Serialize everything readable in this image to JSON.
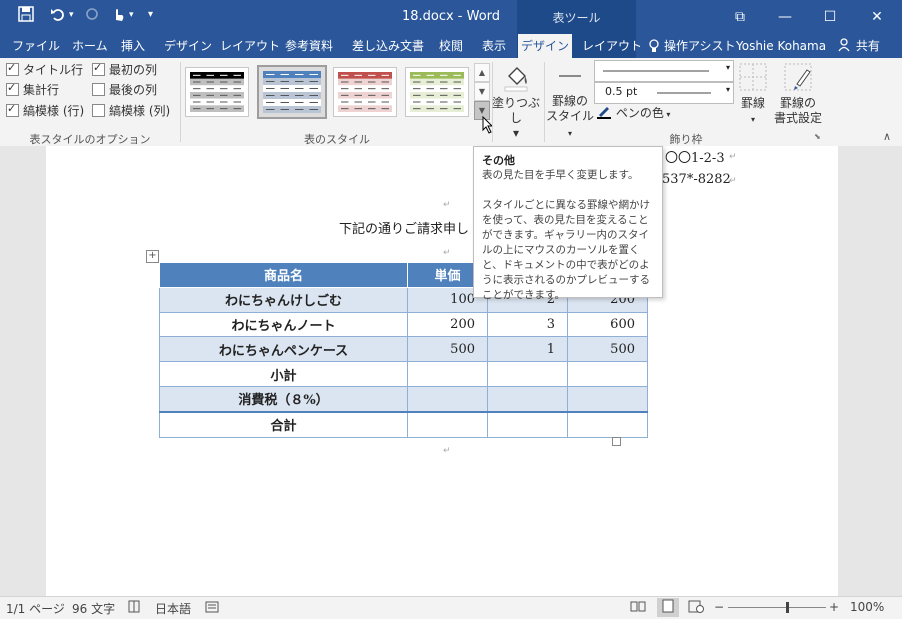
{
  "window": {
    "title": "18.docx - Word",
    "context_group": "表ツール",
    "qat": {
      "save_icon": "save-icon",
      "undo_icon": "undo-icon",
      "redo_icon": "redo-icon",
      "touch_icon": "touch-mode-icon",
      "more": "▾"
    },
    "buttons": {
      "ribbon_display": "⧉",
      "minimize": "—",
      "maximize": "☐",
      "close": "✕"
    }
  },
  "tabs": [
    "ファイル",
    "ホーム",
    "挿入",
    "デザイン",
    "レイアウト",
    "参考資料",
    "差し込み文書",
    "校閲",
    "表示",
    "デザイン",
    "レイアウト"
  ],
  "active_tab_index": 9,
  "tell_me": "操作アシスト",
  "user": "Yoshie Kohama",
  "share": "共有",
  "ribbon": {
    "style_options": {
      "items": [
        {
          "label": "タイトル行",
          "checked": true
        },
        {
          "label": "最初の列",
          "checked": true
        },
        {
          "label": "集計行",
          "checked": true
        },
        {
          "label": "最後の列",
          "checked": false
        },
        {
          "label": "縞模様 (行)",
          "checked": true
        },
        {
          "label": "縞模様 (列)",
          "checked": false
        }
      ],
      "group_label": "表スタイルのオプション"
    },
    "table_styles": {
      "group_label": "表のスタイル",
      "swatch_colors": [
        "#000000",
        "#4f81bd",
        "#c0504d",
        "#9bbb59"
      ],
      "selected_index": 1
    },
    "shading": {
      "label1": "塗りつぶし",
      "arrow": "▾"
    },
    "borders_group": {
      "border_styles_label": "罫線の",
      "border_styles_label2": "スタイル",
      "pen_weight": "0.5 pt",
      "pen_color": "ペンの色",
      "borders": "罫線",
      "border_painter1": "罫線の",
      "border_painter2": "書式設定",
      "group_label": "飾り枠"
    }
  },
  "document": {
    "address_line1": "〇〇1-2-3",
    "address_line2": "537*-8282",
    "body_line": "下記の通りご請求申し",
    "table": {
      "header": [
        "商品名",
        "単価"
      ],
      "rows": [
        [
          "わにちゃんけしごむ",
          "100",
          "2",
          "200"
        ],
        [
          "わにちゃんノート",
          "200",
          "3",
          "600"
        ],
        [
          "わにちゃんペンケース",
          "500",
          "1",
          "500"
        ],
        [
          "小計",
          "",
          "",
          ""
        ],
        [
          "消費税（８%）",
          "",
          "",
          ""
        ],
        [
          "合計",
          "",
          "",
          ""
        ]
      ]
    }
  },
  "tooltip": {
    "title": "その他",
    "line1": "表の見た目を手早く変更します。",
    "body": "スタイルごとに異なる罫線や網かけを使って、表の見た目を変えることができます。ギャラリー内のスタイルの上にマウスのカーソルを置くと、ドキュメントの中で表がどのように表示されるのかプレビューすることができます。"
  },
  "status": {
    "page": "1/1 ページ",
    "words": "96 文字",
    "language": "日本語",
    "zoom": "100%",
    "zoom_value": 0.6
  }
}
